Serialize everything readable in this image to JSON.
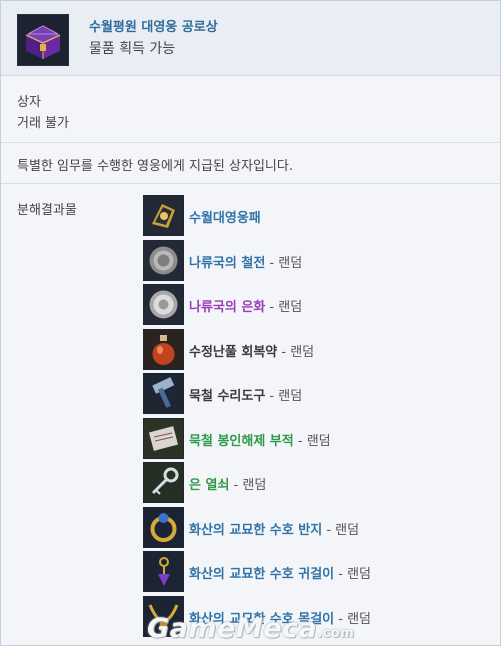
{
  "item": {
    "name": "수월평원 대영웅 공로상",
    "acquire": "물품 획득 가능",
    "type": "상자",
    "trade": "거래 불가",
    "description": "특별한 임무를 수행한 영웅에게 지급된 상자입니다.",
    "icon": "purple-chest-icon"
  },
  "decompose": {
    "label": "분해결과물",
    "results": [
      {
        "name": "수월대영웅패",
        "suffix": "",
        "color": "#2f73a8",
        "icon": "golden-medal-icon"
      },
      {
        "name": "나류국의 철전",
        "suffix": " - 랜덤",
        "color": "#2f73a8",
        "icon": "iron-coin-icon"
      },
      {
        "name": "나류국의 은화",
        "suffix": " - 랜덤",
        "color": "#9b3dba",
        "icon": "silver-coin-icon"
      },
      {
        "name": "수정난풀 회복약",
        "suffix": " - 랜덤",
        "color": "#3a3a3a",
        "icon": "potion-icon"
      },
      {
        "name": "묵철 수리도구",
        "suffix": " - 랜덤",
        "color": "#3a3a3a",
        "icon": "hammer-icon"
      },
      {
        "name": "묵철 봉인해제 부적",
        "suffix": " - 랜덤",
        "color": "#2f9a4a",
        "icon": "talisman-icon"
      },
      {
        "name": "은 열쇠",
        "suffix": " - 랜덤",
        "color": "#2f9a4a",
        "icon": "key-icon"
      },
      {
        "name": "화산의 교묘한 수호 반지",
        "suffix": " - 랜덤",
        "color": "#2f73a8",
        "icon": "ring-icon"
      },
      {
        "name": "화산의 교묘한 수호 귀걸이",
        "suffix": " - 랜덤",
        "color": "#2f73a8",
        "icon": "earring-icon"
      },
      {
        "name": "화산의 교묘한 수호 목걸이",
        "suffix": " - 랜덤",
        "color": "#2f73a8",
        "icon": "necklace-icon"
      }
    ]
  },
  "watermark": {
    "text": "GameMeca",
    "suffix": ".com"
  }
}
